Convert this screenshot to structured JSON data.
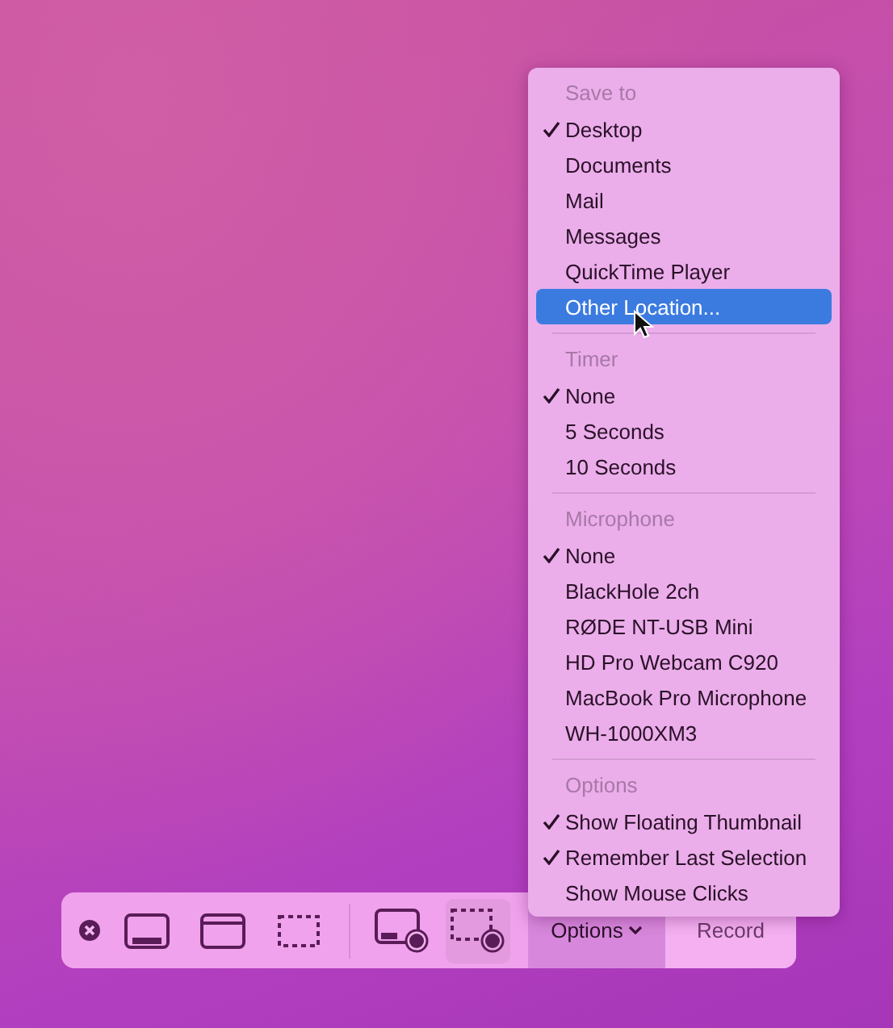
{
  "menu": {
    "sections": [
      {
        "header": "Save to",
        "items": [
          {
            "label": "Desktop",
            "checked": true,
            "selected": false
          },
          {
            "label": "Documents",
            "checked": false,
            "selected": false
          },
          {
            "label": "Mail",
            "checked": false,
            "selected": false
          },
          {
            "label": "Messages",
            "checked": false,
            "selected": false
          },
          {
            "label": "QuickTime Player",
            "checked": false,
            "selected": false
          },
          {
            "label": "Other Location...",
            "checked": false,
            "selected": true
          }
        ]
      },
      {
        "header": "Timer",
        "items": [
          {
            "label": "None",
            "checked": true,
            "selected": false
          },
          {
            "label": "5 Seconds",
            "checked": false,
            "selected": false
          },
          {
            "label": "10 Seconds",
            "checked": false,
            "selected": false
          }
        ]
      },
      {
        "header": "Microphone",
        "items": [
          {
            "label": "None",
            "checked": true,
            "selected": false
          },
          {
            "label": "BlackHole 2ch",
            "checked": false,
            "selected": false
          },
          {
            "label": "RØDE NT-USB Mini",
            "checked": false,
            "selected": false
          },
          {
            "label": "HD Pro Webcam C920",
            "checked": false,
            "selected": false
          },
          {
            "label": "MacBook Pro Microphone",
            "checked": false,
            "selected": false
          },
          {
            "label": "WH-1000XM3",
            "checked": false,
            "selected": false
          }
        ]
      },
      {
        "header": "Options",
        "items": [
          {
            "label": "Show Floating Thumbnail",
            "checked": true,
            "selected": false
          },
          {
            "label": "Remember Last Selection",
            "checked": true,
            "selected": false
          },
          {
            "label": "Show Mouse Clicks",
            "checked": false,
            "selected": false
          }
        ]
      }
    ]
  },
  "toolbar": {
    "capture_tools": [
      {
        "kind": "screen",
        "selected": false
      },
      {
        "kind": "window",
        "selected": false
      },
      {
        "kind": "selection",
        "selected": false
      }
    ],
    "record_tools": [
      {
        "kind": "record-screen",
        "selected": false
      },
      {
        "kind": "record-selection",
        "selected": true
      }
    ],
    "options_button": {
      "label": "Options",
      "selected": true
    },
    "record_button": {
      "label": "Record"
    }
  }
}
